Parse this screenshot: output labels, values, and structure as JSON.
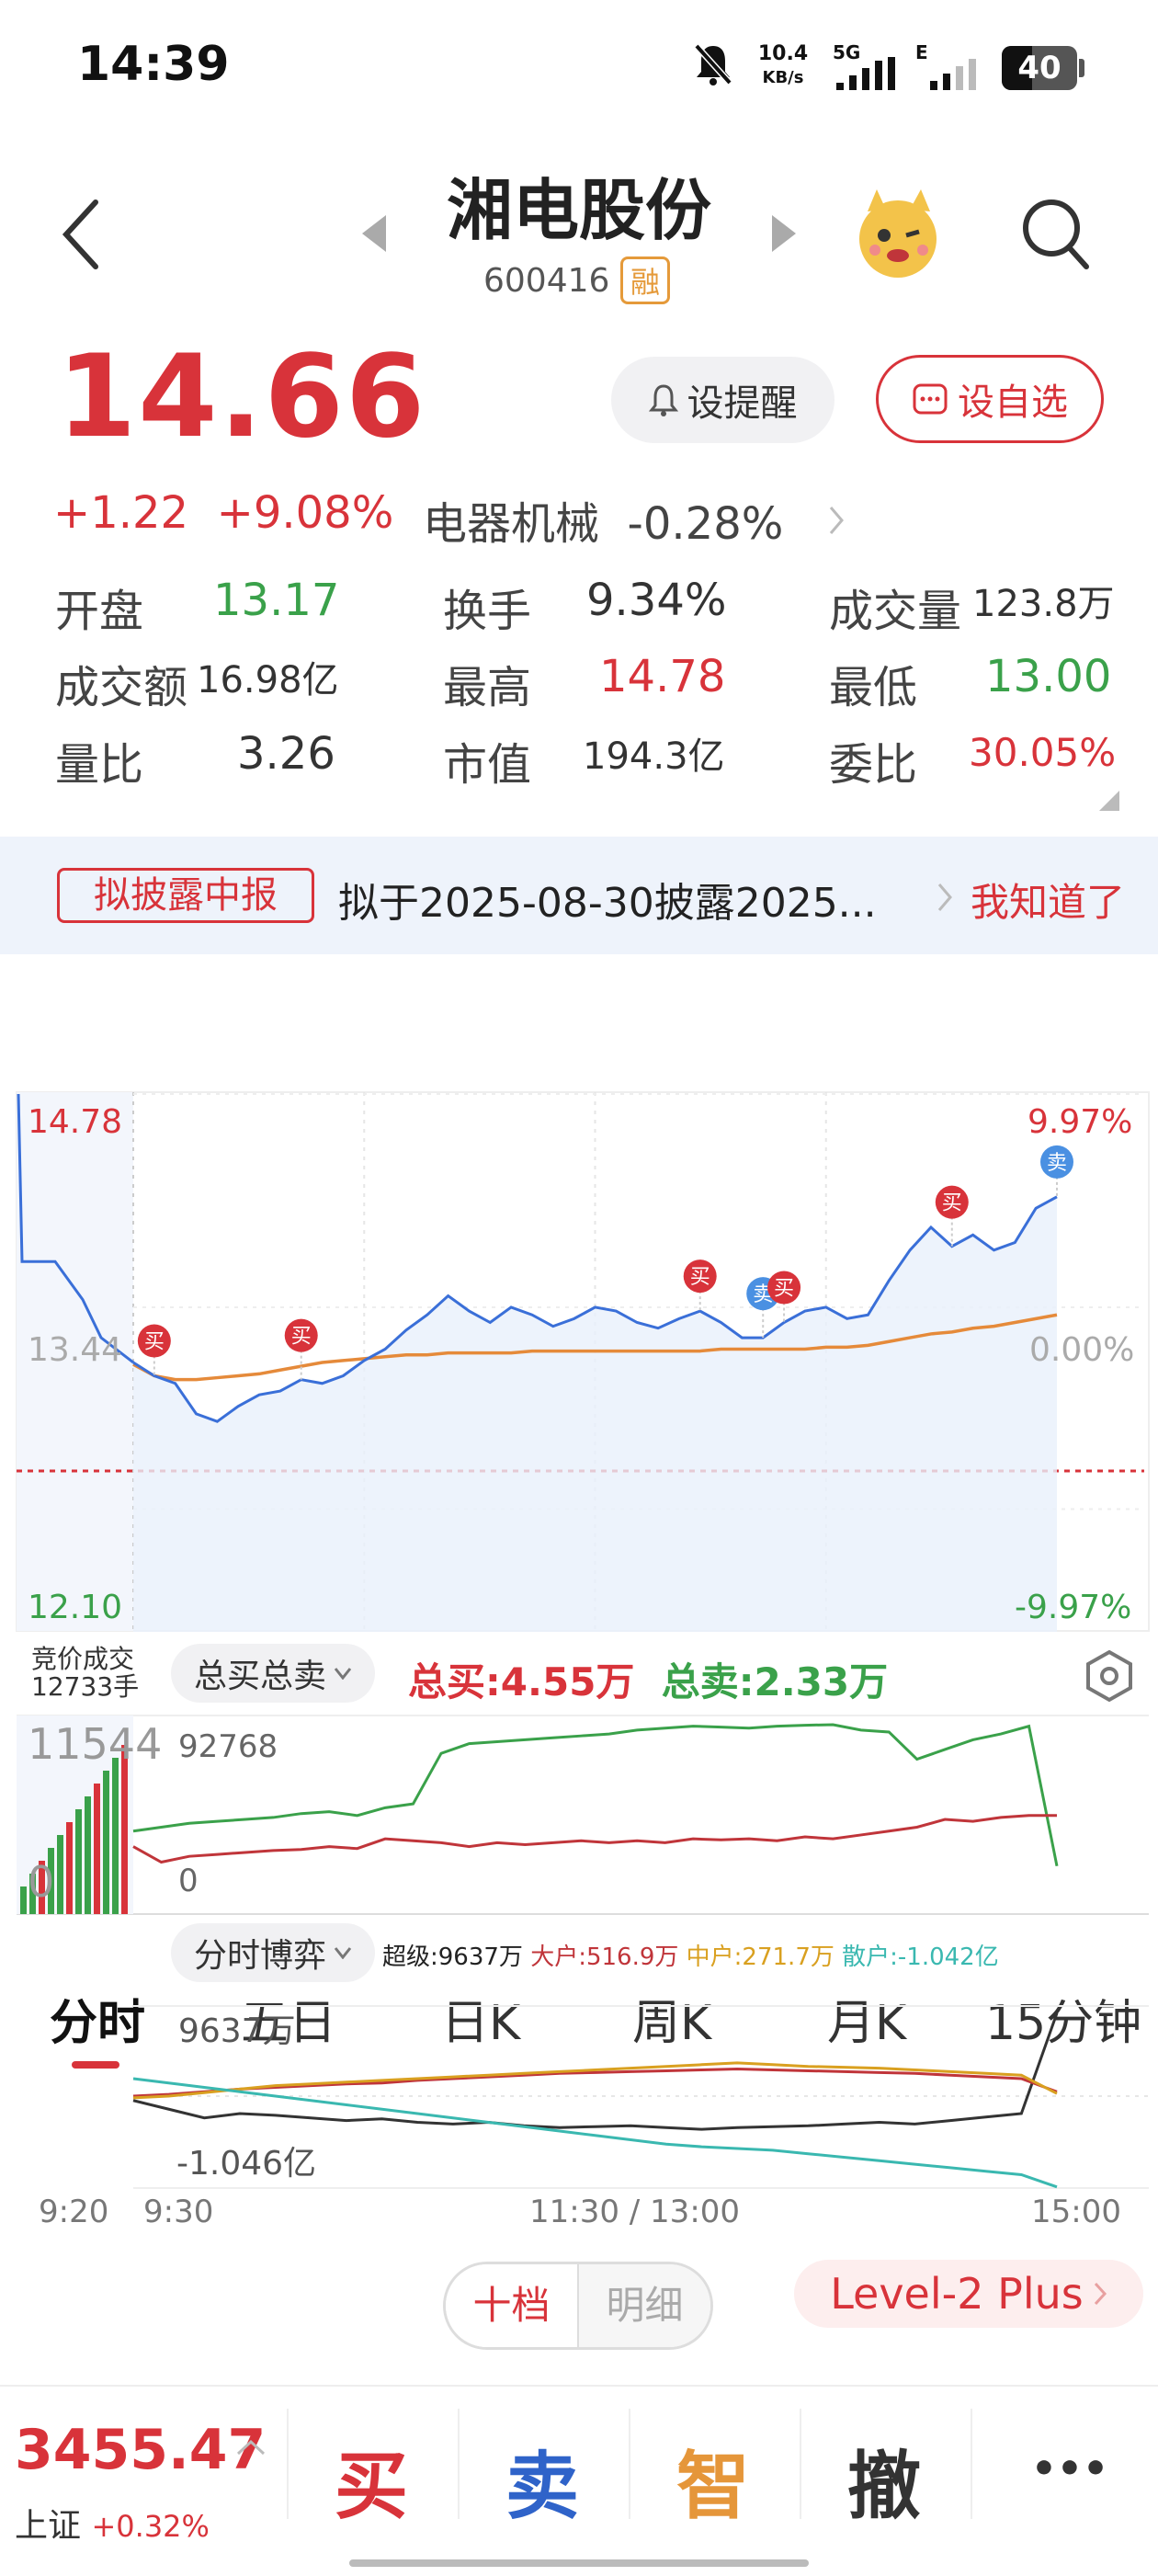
{
  "status_bar": {
    "time": "14:39",
    "net_speed_value": "10.4",
    "net_speed_unit": "KB/s",
    "network": "5G",
    "network2": "E",
    "battery": "40"
  },
  "header": {
    "stock_name": "湘电股份",
    "stock_code": "600416",
    "margin_badge": "融"
  },
  "quote": {
    "price": "14.66",
    "change": "+1.22",
    "change_pct": "+9.08%",
    "sector_name": "电器机械",
    "sector_pct": "-0.28%",
    "remind_label": "设提醒",
    "watch_label": "设自选",
    "stats": [
      {
        "label": "开盘",
        "value": "13.17"
      },
      {
        "label": "换手",
        "value": "9.34%"
      },
      {
        "label": "成交量",
        "value": "123.8万"
      },
      {
        "label": "成交额",
        "value": "16.98亿"
      },
      {
        "label": "最高",
        "value": "14.78"
      },
      {
        "label": "最低",
        "value": "13.00"
      },
      {
        "label": "量比",
        "value": "3.26"
      },
      {
        "label": "市值",
        "value": "194.3亿"
      },
      {
        "label": "委比",
        "value": "30.05%"
      }
    ]
  },
  "notice": {
    "tag": "拟披露中报",
    "text": "拟于2025-08-30披露2025...",
    "dismiss": "我知道了"
  },
  "tabs": [
    "分时",
    "五日",
    "日K",
    "周K",
    "月K",
    "15分钟"
  ],
  "chart_data": [
    {
      "type": "line",
      "title": "分时",
      "ylim": [
        12.1,
        14.78
      ],
      "y_left_labels": [
        "14.78",
        "13.44",
        "12.10"
      ],
      "y_right_labels": [
        "9.97%",
        "0.00%",
        "-9.97%"
      ],
      "x_tick_labels": [
        "9:20",
        "9:30",
        "11:30 / 13:00",
        "15:00"
      ],
      "series": [
        {
          "name": "price",
          "color": "#3a6fd8",
          "values": [
            13.37,
            13.3,
            13.26,
            13.1,
            13.06,
            13.14,
            13.2,
            13.22,
            13.28,
            13.26,
            13.3,
            13.38,
            13.44,
            13.54,
            13.62,
            13.72,
            13.64,
            13.58,
            13.66,
            13.62,
            13.56,
            13.6,
            13.66,
            13.64,
            13.58,
            13.55,
            13.6,
            13.64,
            13.58,
            13.5,
            13.5,
            13.58,
            13.64,
            13.66,
            13.6,
            13.62,
            13.8,
            13.96,
            14.08,
            13.98,
            14.04,
            13.96,
            14.0,
            14.18,
            14.24
          ]
        },
        {
          "name": "avg",
          "color": "#e58a3a",
          "values": [
            13.36,
            13.3,
            13.28,
            13.28,
            13.29,
            13.3,
            13.31,
            13.33,
            13.35,
            13.37,
            13.38,
            13.39,
            13.4,
            13.41,
            13.41,
            13.42,
            13.42,
            13.42,
            13.42,
            13.43,
            13.43,
            13.43,
            13.43,
            13.43,
            13.43,
            13.43,
            13.43,
            13.43,
            13.44,
            13.44,
            13.44,
            13.44,
            13.44,
            13.45,
            13.45,
            13.46,
            13.48,
            13.5,
            13.52,
            13.53,
            13.55,
            13.56,
            13.58,
            13.6,
            13.62
          ]
        }
      ],
      "markers": [
        {
          "label": "买",
          "index": 1,
          "kind": "buy"
        },
        {
          "label": "买",
          "index": 8,
          "kind": "buy"
        },
        {
          "label": "买",
          "index": 27,
          "kind": "buy"
        },
        {
          "label": "卖",
          "index": 30,
          "kind": "sell"
        },
        {
          "label": "买",
          "index": 31,
          "kind": "buy"
        },
        {
          "label": "买",
          "index": 39,
          "kind": "buy"
        },
        {
          "label": "卖",
          "index": 44,
          "kind": "sell"
        }
      ]
    },
    {
      "type": "line",
      "title": "总买总卖",
      "auction_label": "竞价成交",
      "auction_value": "12733手",
      "selector": "总买总卖",
      "total_buy_label": "总买:",
      "total_buy": "4.55万",
      "total_sell_label": "总卖:",
      "total_sell": "2.33万",
      "y_labels_left": [
        "11544",
        "0"
      ],
      "y_labels_inner": [
        "92768",
        "0"
      ],
      "series": [
        {
          "name": "总买",
          "color": "#3aa14a",
          "values": [
            38000,
            40000,
            42000,
            43000,
            44000,
            45000,
            47000,
            48000,
            46000,
            50000,
            52000,
            78000,
            83000,
            84000,
            85000,
            86000,
            87000,
            88000,
            90000,
            91000,
            92000,
            91500,
            91000,
            92000,
            92500,
            92768,
            90000,
            89000,
            75000,
            80000,
            85000,
            88000,
            92000,
            20000
          ]
        },
        {
          "name": "总卖",
          "color": "#c0353a",
          "values": [
            30000,
            22000,
            25000,
            26000,
            27000,
            28000,
            28500,
            30000,
            29000,
            34000,
            33000,
            32000,
            30000,
            32000,
            31000,
            32000,
            33000,
            32000,
            33000,
            32000,
            34000,
            33500,
            34000,
            33000,
            35000,
            34000,
            36000,
            38000,
            40000,
            44000,
            43000,
            45000,
            46000,
            46000
          ]
        }
      ]
    },
    {
      "type": "line",
      "title": "分时博弈",
      "selector": "分时博弈",
      "legend": [
        {
          "label": "超级:9637万",
          "color": "#222222"
        },
        {
          "label": "大户:516.9万",
          "color": "#c0353a"
        },
        {
          "label": "中户:271.7万",
          "color": "#d9a020"
        },
        {
          "label": "散户:-1.042亿",
          "color": "#3ab8b0"
        }
      ],
      "y_labels": [
        "9637万",
        "-1.046亿"
      ],
      "series": [
        {
          "name": "超级",
          "color": "#333333",
          "values": [
            -5,
            -15,
            -25,
            -20,
            -22,
            -25,
            -28,
            -26,
            -30,
            -32,
            -30,
            -34,
            -36,
            -35,
            -34,
            -36,
            -38,
            -36,
            -35,
            -34,
            -32,
            -30,
            -32,
            -28,
            -24,
            -20,
            95
          ]
        },
        {
          "name": "大户",
          "color": "#c0353a",
          "values": [
            0,
            2,
            5,
            8,
            10,
            12,
            14,
            15,
            18,
            20,
            22,
            24,
            26,
            27,
            28,
            29,
            30,
            31,
            30,
            29,
            28,
            27,
            26,
            24,
            22,
            20,
            5
          ]
        },
        {
          "name": "中户",
          "color": "#d9a020",
          "values": [
            -2,
            0,
            4,
            8,
            12,
            14,
            16,
            18,
            20,
            22,
            24,
            26,
            28,
            30,
            32,
            34,
            36,
            38,
            36,
            34,
            33,
            32,
            30,
            28,
            26,
            24,
            3
          ]
        },
        {
          "name": "散户",
          "color": "#3ab8b0",
          "values": [
            20,
            15,
            10,
            5,
            0,
            -5,
            -10,
            -15,
            -20,
            -25,
            -30,
            -35,
            -40,
            -45,
            -50,
            -55,
            -58,
            -60,
            -62,
            -66,
            -70,
            -74,
            -78,
            -82,
            -86,
            -90,
            -104
          ]
        }
      ]
    }
  ],
  "order_book": {
    "tab_ten": "十档",
    "tab_detail": "明细",
    "level2": "Level-2 Plus"
  },
  "bottom": {
    "index_value": "3455.47",
    "index_name": "上证",
    "index_pct": "+0.32%",
    "buy": "买",
    "sell": "卖",
    "smart": "智",
    "cancel": "撤",
    "more": "•••"
  }
}
